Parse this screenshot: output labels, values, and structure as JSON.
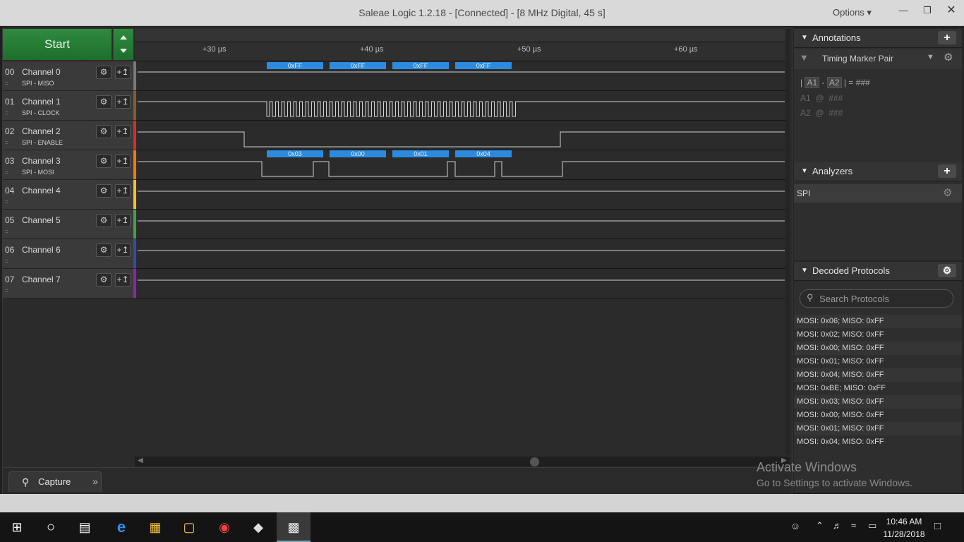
{
  "window": {
    "title": "Saleae Logic 1.2.18 - [Connected] - [8 MHz Digital, 45 s]",
    "options_label": "Options ▾"
  },
  "toolbar": {
    "start_label": "Start"
  },
  "timeline": {
    "ticks": [
      "+30 µs",
      "+40 µs",
      "+50 µs",
      "+60 µs"
    ]
  },
  "channels": [
    {
      "num": "00",
      "name": "Channel 0",
      "sub": "SPI - MISO",
      "color": "#7a7a7a"
    },
    {
      "num": "01",
      "name": "Channel 1",
      "sub": "SPI - CLOCK",
      "color": "#8b5a2b"
    },
    {
      "num": "02",
      "name": "Channel 2",
      "sub": "SPI - ENABLE",
      "color": "#d32f2f"
    },
    {
      "num": "03",
      "name": "Channel 3",
      "sub": "SPI - MOSI",
      "color": "#f57c00"
    },
    {
      "num": "04",
      "name": "Channel 4",
      "sub": "",
      "color": "#fbc02d"
    },
    {
      "num": "05",
      "name": "Channel 5",
      "sub": "",
      "color": "#43a047"
    },
    {
      "num": "06",
      "name": "Channel 6",
      "sub": "",
      "color": "#3949ab"
    },
    {
      "num": "07",
      "name": "Channel 7",
      "sub": "",
      "color": "#8e24aa"
    }
  ],
  "miso_labels": [
    "0xFF",
    "0xFF",
    "0xFF",
    "0xFF"
  ],
  "mosi_labels": [
    "0x03",
    "0x00",
    "0x01",
    "0x04"
  ],
  "capture_tab": "Capture",
  "annotations": {
    "header": "Annotations",
    "marker_label": "Timing Marker Pair",
    "line1_a1": "A1",
    "line1_a2": "A2",
    "line1_value": "###",
    "a1_label": "A1",
    "a1_value": "###",
    "a2_label": "A2",
    "a2_value": "###"
  },
  "analyzers": {
    "header": "Analyzers",
    "items": [
      "SPI"
    ]
  },
  "decoded": {
    "header": "Decoded Protocols",
    "search_placeholder": "Search Protocols",
    "rows": [
      "MOSI: 0x06;  MISO: 0xFF",
      "MOSI: 0x02;  MISO: 0xFF",
      "MOSI: 0x00;  MISO: 0xFF",
      "MOSI: 0x01;  MISO: 0xFF",
      "MOSI: 0x04;  MISO: 0xFF",
      "MOSI: 0xBE;  MISO: 0xFF",
      "MOSI: 0x03;  MISO: 0xFF",
      "MOSI: 0x00;  MISO: 0xFF",
      "MOSI: 0x01;  MISO: 0xFF",
      "MOSI: 0x04;  MISO: 0xFF"
    ]
  },
  "watermark": {
    "line1": "Activate Windows",
    "line2": "Go to Settings to activate Windows."
  },
  "taskbar": {
    "time": "10:46 AM",
    "date": "11/28/2018"
  }
}
